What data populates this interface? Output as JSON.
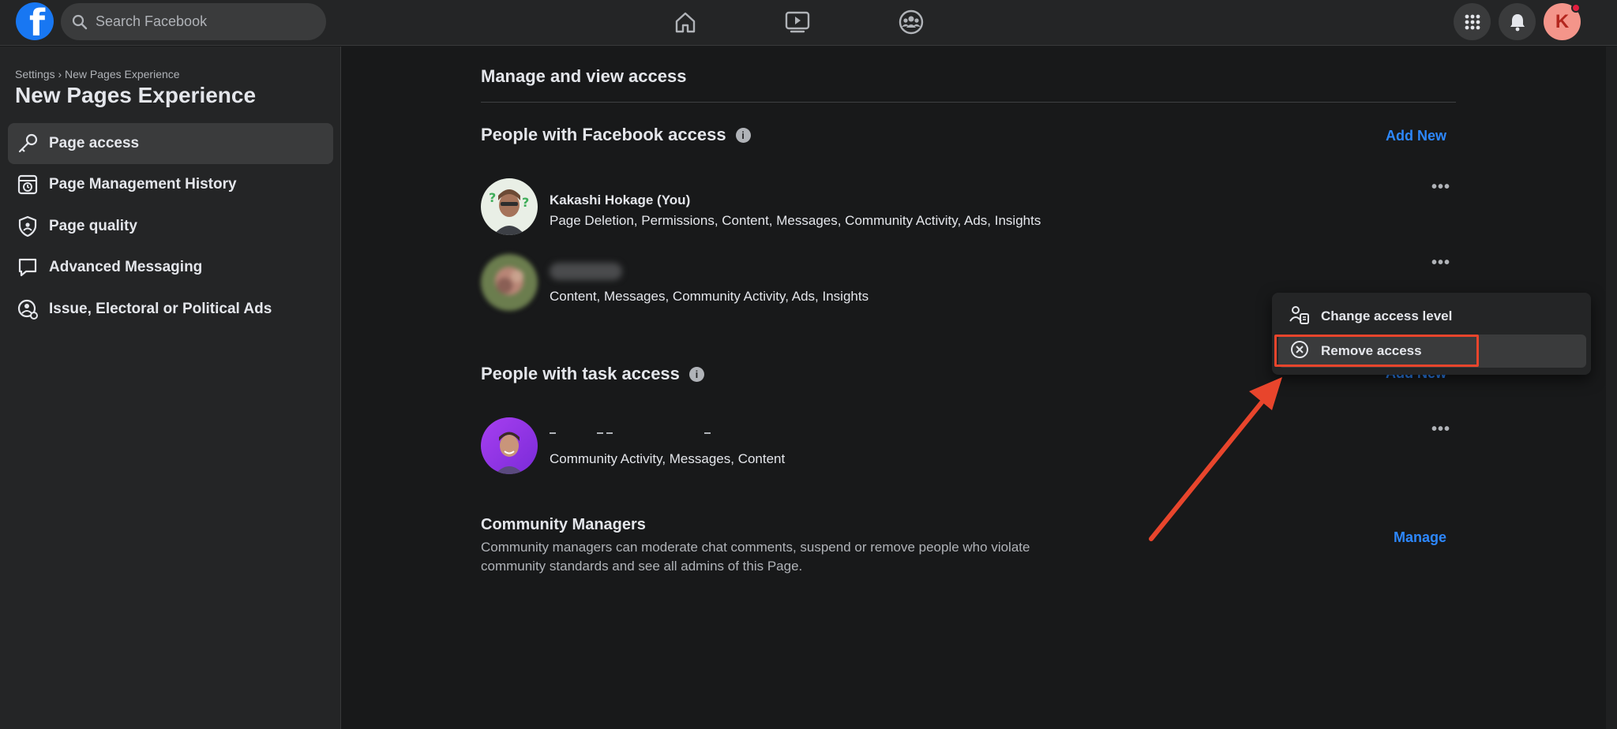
{
  "topbar": {
    "logo_letter": "f",
    "search_placeholder": "Search Facebook",
    "avatar_letter": "K",
    "nav_icons": [
      "home-icon",
      "watch-icon",
      "groups-icon"
    ],
    "right_icons": [
      "menu-grid-icon",
      "notifications-icon"
    ]
  },
  "sidebar": {
    "breadcrumb": "Settings › New Pages Experience",
    "title": "New Pages Experience",
    "items": [
      {
        "label": "Page access",
        "icon": "key-icon",
        "active": true
      },
      {
        "label": "Page Management History",
        "icon": "history-icon"
      },
      {
        "label": "Page quality",
        "icon": "shield-icon"
      },
      {
        "label": "Advanced Messaging",
        "icon": "message-icon"
      },
      {
        "label": "Issue, Electoral or Political Ads",
        "icon": "political-ads-icon"
      }
    ]
  },
  "main": {
    "heading": "Manage and view access",
    "facebook_access": {
      "title": "People with Facebook access",
      "add_new": "Add New",
      "people": [
        {
          "name": "Kakashi Hokage (You)",
          "permissions": "Page Deletion, Permissions, Content, Messages, Community Activity, Ads, Insights"
        },
        {
          "name": "",
          "permissions": "Content, Messages, Community Activity, Ads, Insights"
        }
      ]
    },
    "task_access": {
      "title": "People with task access",
      "add_new": "Add New",
      "people": [
        {
          "name": "",
          "permissions": "Community Activity, Messages, Content"
        }
      ]
    },
    "community_managers": {
      "title": "Community Managers",
      "description": "Community managers can moderate chat comments, suspend or remove people who violate community standards and see all admins of this Page.",
      "manage": "Manage"
    },
    "more_label": "•••"
  },
  "menu": {
    "items": [
      {
        "label": "Change access level",
        "icon": "change-access-icon"
      },
      {
        "label": "Remove access",
        "icon": "remove-circle-icon",
        "highlighted": true
      }
    ]
  },
  "colors": {
    "accent": "#2d88ff",
    "brand": "#1877f2",
    "annotation": "#e8452c"
  }
}
